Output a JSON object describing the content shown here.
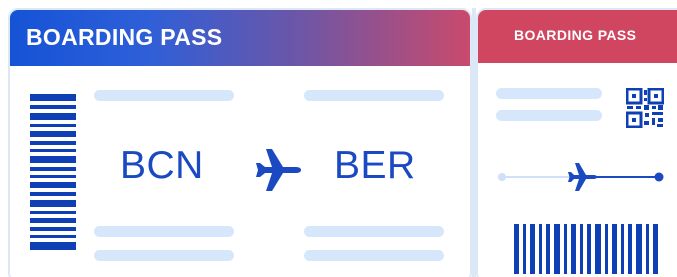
{
  "ticket": {
    "title": "BOARDING PASS",
    "origin": "BCN",
    "destination": "BER"
  },
  "stub": {
    "title": "BOARDING PASS"
  },
  "icons": {
    "flight": "airplane-icon",
    "stub_flight": "airplane-icon",
    "code": "qr-code-icon",
    "barcode": "barcode-icon"
  },
  "colors": {
    "header_gradient_start": "#1553d6",
    "header_gradient_end": "#c94a6c",
    "stub_header": "#d0455f",
    "accent_blue": "#1a49c2",
    "placeholder": "#d6e6fb"
  }
}
